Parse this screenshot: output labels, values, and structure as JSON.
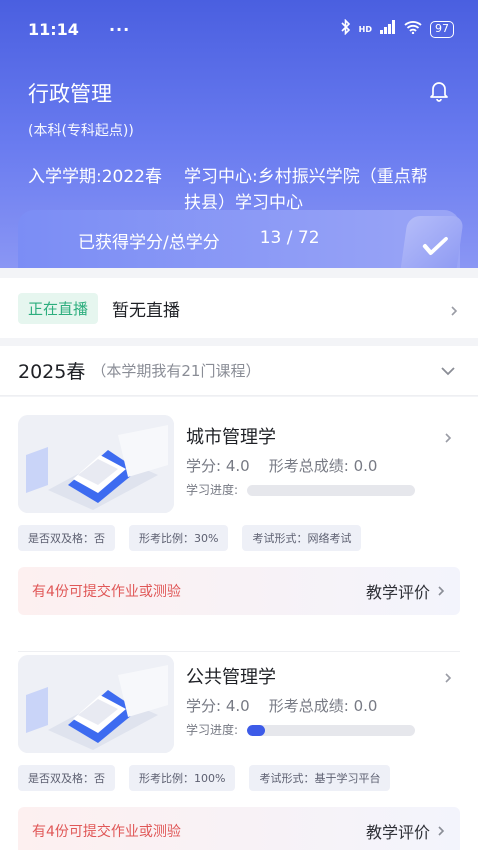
{
  "status_bar": {
    "time": "11:14",
    "dots": "···",
    "network": "HD",
    "battery": "97"
  },
  "header": {
    "major": "行政管理",
    "level": "(本科(专科起点))",
    "term_label": "入学学期:2022春",
    "center_label": "学习中心:乡村振兴学院（重点帮扶县）学习中心"
  },
  "credits": {
    "label": "已获得学分/总学分",
    "value": "13 / 72"
  },
  "live": {
    "tag": "正在直播",
    "text": "暂无直播"
  },
  "semester": {
    "title": "2025春",
    "subtitle": "（本学期我有21门课程）"
  },
  "courses": [
    {
      "name": "城市管理学",
      "credit": "学分: 4.0",
      "score": "形考总成绩: 0.0",
      "progress_label": "学习进度:",
      "progress": 0,
      "tags": [
        "是否双及格：否",
        "形考比例：30%",
        "考试形式：网络考试"
      ],
      "homework": "有4份可提交作业或测验",
      "evaluate": "教学评价"
    },
    {
      "name": "公共管理学",
      "credit": "学分: 4.0",
      "score": "形考总成绩: 0.0",
      "progress_label": "学习进度:",
      "progress": 0.11,
      "tags": [
        "是否双及格：否",
        "形考比例：100%",
        "考试形式：基于学习平台"
      ],
      "homework": "有4份可提交作业或测验",
      "evaluate": "教学评价"
    }
  ],
  "colors": {
    "accent": "#3d5be8",
    "live_green": "#2dae7e",
    "warn_red": "#e05757"
  }
}
